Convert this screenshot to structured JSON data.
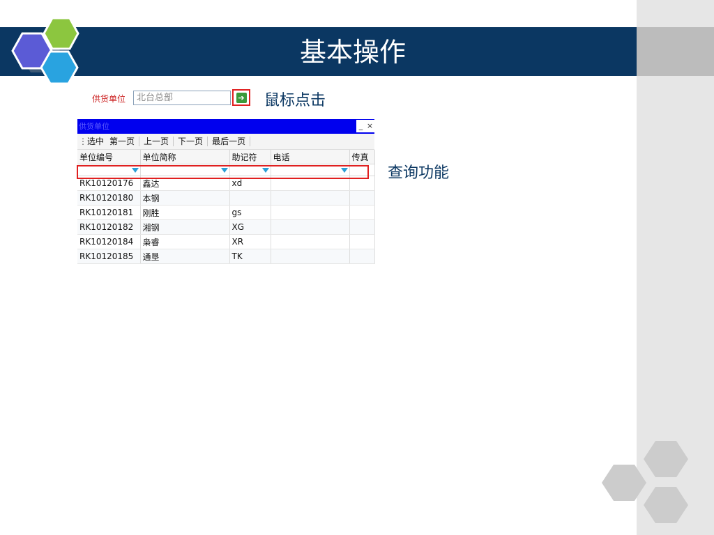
{
  "slide": {
    "title": "基本操作"
  },
  "supplier": {
    "label": "供货单位",
    "value": "北台总部",
    "go_icon": "arrow-right-icon"
  },
  "annotations": {
    "click_note": "鼠标点击",
    "query_note": "查询功能"
  },
  "popup": {
    "title": "供货单位",
    "minimize": "_",
    "close": "×",
    "toolbar": [
      "选中",
      "第一页",
      "上一页",
      "下一页",
      "最后一页"
    ],
    "columns": [
      "单位编号",
      "单位简称",
      "助记符",
      "电话",
      "传真"
    ],
    "rows": [
      [
        "RK10120176",
        "鑫达",
        "xd",
        "",
        ""
      ],
      [
        "RK10120180",
        "本钢",
        "",
        "",
        ""
      ],
      [
        "RK10120181",
        "刚胜",
        "gs",
        "",
        ""
      ],
      [
        "RK10120182",
        "湘钢",
        "XG",
        "",
        ""
      ],
      [
        "RK10120184",
        "枭睿",
        "XR",
        "",
        ""
      ],
      [
        "RK10120185",
        "通垦",
        "TK",
        "",
        ""
      ]
    ]
  },
  "colors": {
    "banner": "#0b3762",
    "highlight": "#e02020",
    "popup_titlebar": "#0000ee",
    "hex_green": "#8cc63f",
    "hex_purple": "#5b5bd6",
    "hex_blue": "#29a3e0",
    "hex_gray": "#cccccc"
  }
}
